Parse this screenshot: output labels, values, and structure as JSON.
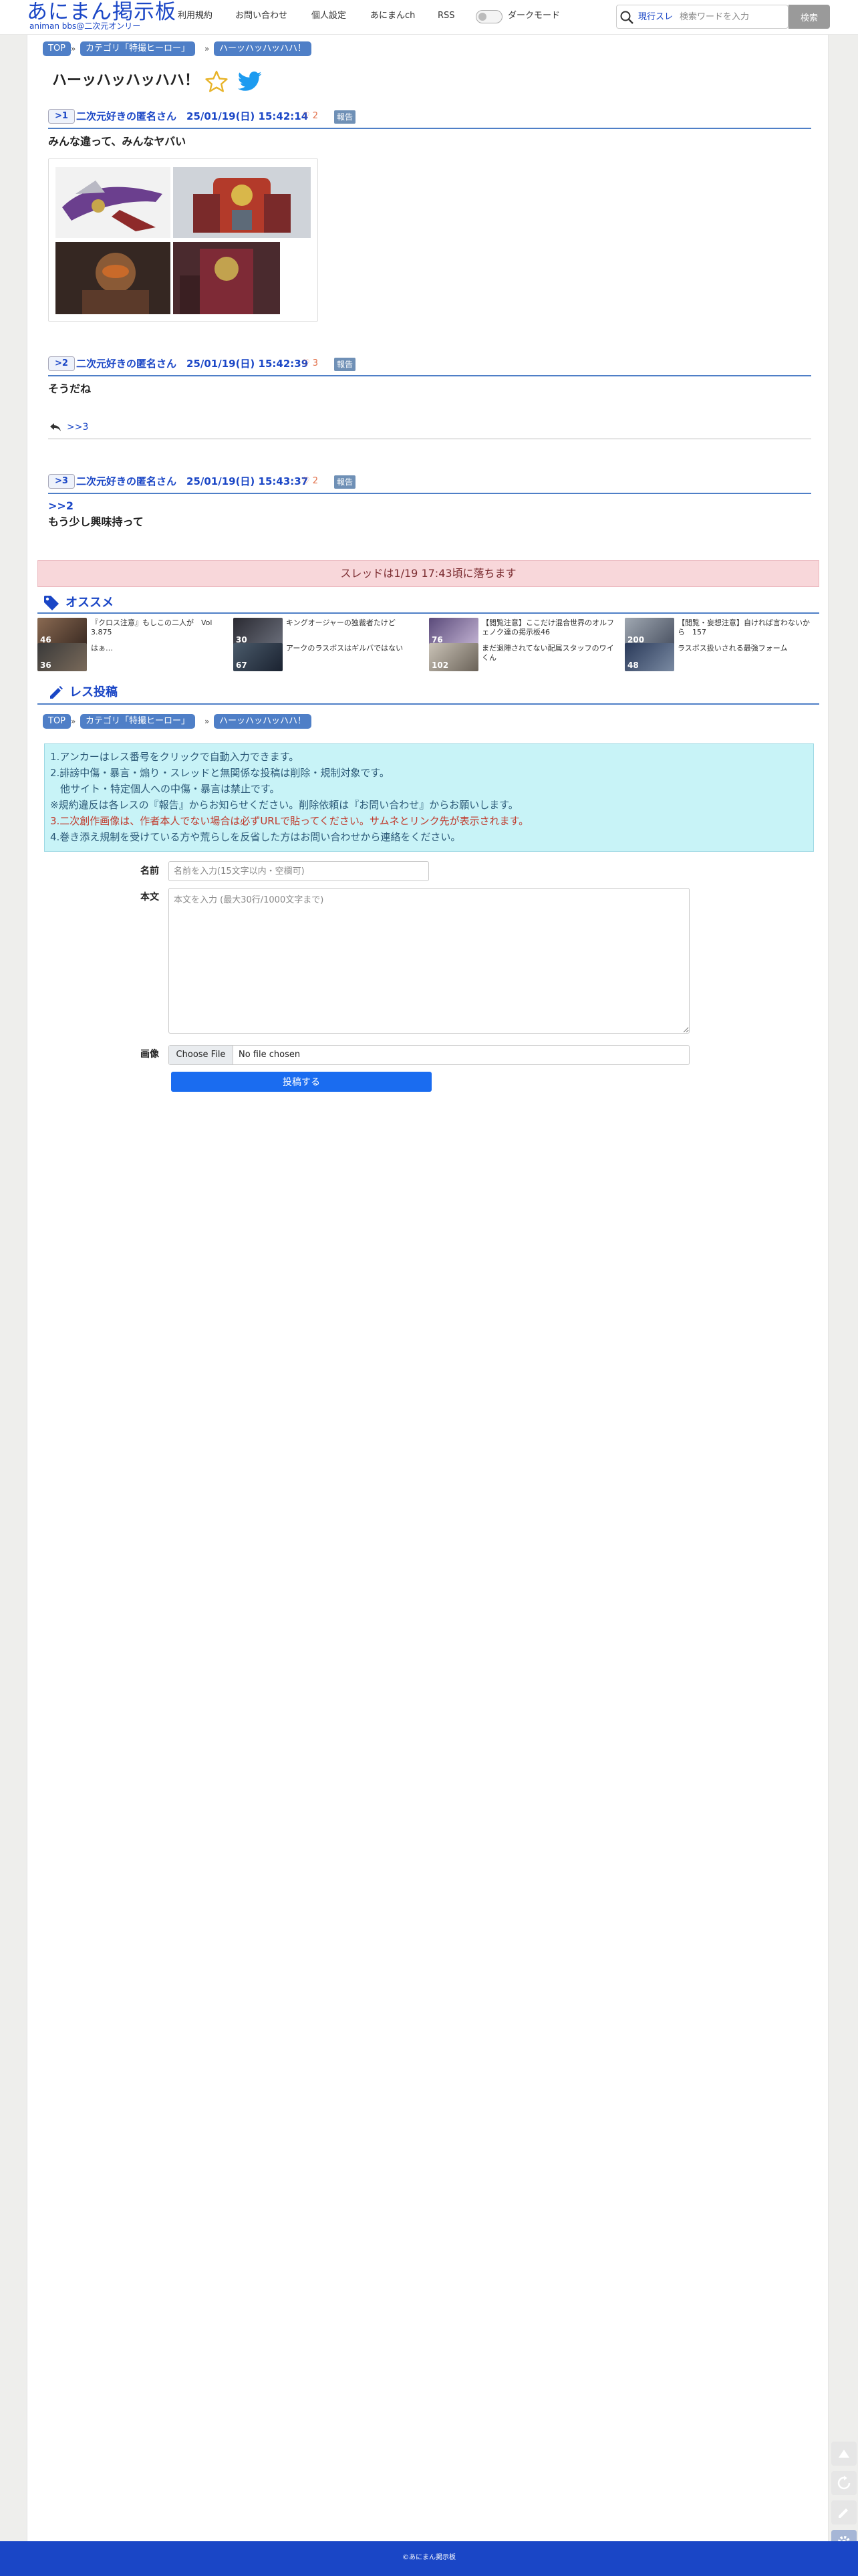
{
  "header": {
    "logo_title": "あにまん掲示板",
    "logo_subtitle": "animan bbs@二次元オンリー",
    "nav": [
      "利用規約",
      "お問い合わせ",
      "個人設定",
      "あにまんch",
      "RSS"
    ],
    "dark_mode_label": "ダークモード",
    "search_scope": "現行スレ",
    "search_placeholder": "検索ワードを入力",
    "search_button": "検索"
  },
  "breadcrumb": [
    "TOP",
    "カテゴリ「特撮ヒーロー」",
    "ハーッハッハッハハ！"
  ],
  "breadcrumb_sep": "»",
  "thread": {
    "title": "ハーッハッハッハハ！"
  },
  "posts": [
    {
      "num": ">1",
      "meta": "二次元好きの匿名さん　25/01/19(日) 15:42:14",
      "likes": "♡ 2",
      "report": "報告",
      "body": "みんな違って、みんなヤバい"
    },
    {
      "num": ">2",
      "meta": "二次元好きの匿名さん　25/01/19(日) 15:42:39",
      "likes": "♡ 3",
      "report": "報告",
      "body": "そうだね",
      "reply": ">>3"
    },
    {
      "num": ">3",
      "meta": "二次元好きの匿名さん　25/01/19(日) 15:43:37",
      "likes": "♡ 2",
      "report": "報告",
      "anchor": ">>2",
      "body": "もう少し興味持って"
    }
  ],
  "notice": "スレッドは1/19 17:43頃に落ちます",
  "recommend": {
    "title": "オススメ",
    "items": [
      {
        "text": "『クロス注意』もしこの二人が　Vol 3.875",
        "count": "46"
      },
      {
        "text": "キングオージャーの独裁者たけど",
        "count": "30"
      },
      {
        "text": "【閲覧注意】ここだけ混合世界のオルフェノク達の掲示板46",
        "count": "76"
      },
      {
        "text": "【閲覧・妄想注意】自ければ言わないから　157",
        "count": "200"
      },
      {
        "text": "はぁ…",
        "count": "36"
      },
      {
        "text": "アークのラスボスはギルバではない",
        "count": "67"
      },
      {
        "text": "まだ退陣されてない配属スタッフのワイくん",
        "count": "102"
      },
      {
        "text": "ラスボス扱いされる最強フォーム",
        "count": "48"
      }
    ]
  },
  "reply_form": {
    "title": "レス投稿",
    "rules": [
      "1.アンカーはレス番号をクリックで自動入力できます。",
      "2.誹謗中傷・暴言・煽り・スレッドと無関係な投稿は削除・規制対象です。",
      "　他サイト・特定個人への中傷・暴言は禁止です。",
      "※規約違反は各レスの『報告』からお知らせください。削除依頼は『お問い合わせ』からお願いします。",
      "3.二次創作画像は、作者本人でない場合は必ずURLで貼ってください。サムネとリンク先が表示されます。",
      "4.巻き添え規制を受けている方や荒らしを反省した方はお問い合わせから連絡をください。"
    ],
    "name_label": "名前",
    "name_placeholder": "名前を入力(15文字以内・空欄可)",
    "body_label": "本文",
    "body_placeholder": "本文を入力 (最大30行/1000文字まで)",
    "image_label": "画像",
    "file_button": "Choose File",
    "file_status": "No file chosen",
    "submit": "投稿する"
  },
  "footer": "©あにまん掲示板",
  "colors": {
    "brand": "#1a46c6",
    "accent": "#4f7fc7",
    "notice_bg": "#f8d7da",
    "rules_bg": "#c8f3f7",
    "submit": "#1a6cf0"
  }
}
